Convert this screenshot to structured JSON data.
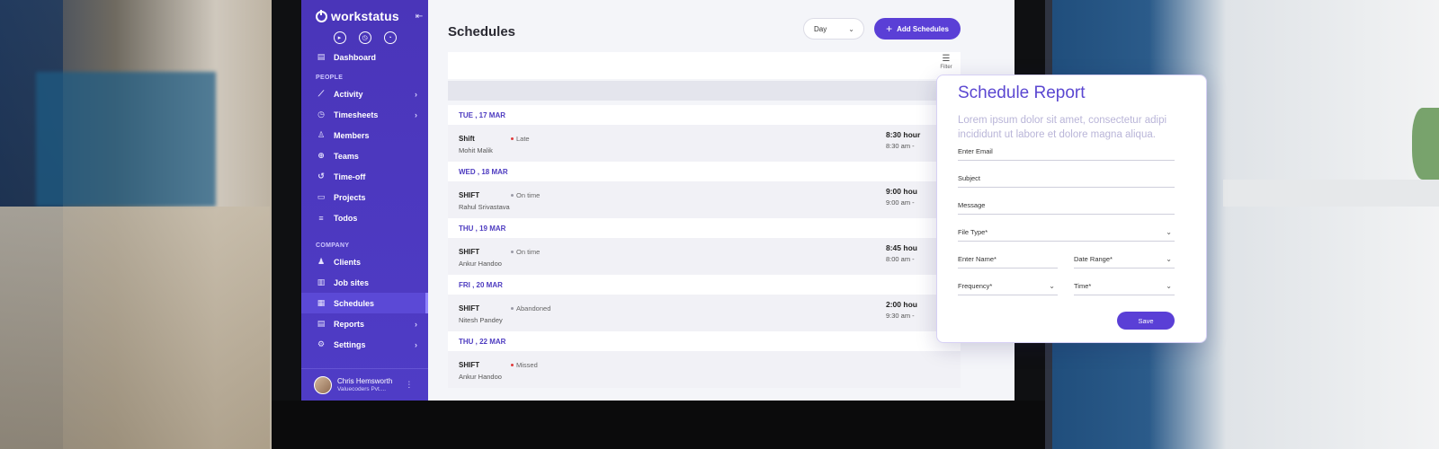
{
  "app": {
    "logo_text": "workstatus"
  },
  "sidebar": {
    "dashboard": "Dashboard",
    "people_label": "PEOPLE",
    "company_label": "COMPANY",
    "people_items": [
      {
        "label": "Activity",
        "icon": "chart-line-icon",
        "has_submenu": true
      },
      {
        "label": "Timesheets",
        "icon": "clock-icon",
        "has_submenu": true
      },
      {
        "label": "Members",
        "icon": "user-icon",
        "has_submenu": false
      },
      {
        "label": "Teams",
        "icon": "team-icon",
        "has_submenu": false
      },
      {
        "label": "Time-off",
        "icon": "time-off-icon",
        "has_submenu": false
      },
      {
        "label": "Projects",
        "icon": "folder-icon",
        "has_submenu": false
      },
      {
        "label": "Todos",
        "icon": "list-icon",
        "has_submenu": false
      }
    ],
    "company_items": [
      {
        "label": "Clients",
        "icon": "clients-icon",
        "has_submenu": false
      },
      {
        "label": "Job sites",
        "icon": "building-icon",
        "has_submenu": false
      },
      {
        "label": "Schedules",
        "icon": "calendar-icon",
        "has_submenu": false,
        "active": true
      },
      {
        "label": "Reports",
        "icon": "report-icon",
        "has_submenu": true
      },
      {
        "label": "Settings",
        "icon": "gear-icon",
        "has_submenu": true
      }
    ],
    "user": {
      "name": "Chris Hemsworth",
      "company": "Valuecoders Pvt...."
    }
  },
  "main": {
    "title": "Schedules",
    "view_select": "Day",
    "add_button": "Add Schedules",
    "filter_label": "Filter",
    "schedule_groups": [
      {
        "date": "TUE , 17 MAR",
        "title": "Shift",
        "name": "Mohit Malik",
        "status": "Late",
        "status_color": "#e03b3b",
        "hours": "8:30 hour",
        "time": "8:30 am -"
      },
      {
        "date": "WED , 18 MAR",
        "title": "SHIFT",
        "name": "Rahul Srivastava",
        "status": "On time",
        "status_color": "#9a9aa6",
        "hours": "9:00 hou",
        "time": "9:00 am -"
      },
      {
        "date": "THU , 19 MAR",
        "title": "SHIFT",
        "name": "Ankur Handoo",
        "status": "On time",
        "status_color": "#9a9aa6",
        "hours": "8:45 hou",
        "time": "8:00 am -"
      },
      {
        "date": "FRI , 20 MAR",
        "title": "SHIFT",
        "name": "Nitesh Pandey",
        "status": "Abandoned",
        "status_color": "#9a9aa6",
        "hours": "2:00 hou",
        "time": "9:30 am -"
      },
      {
        "date": "THU , 22 MAR",
        "title": "SHIFT",
        "name": "Ankur Handoo",
        "status": "Missed",
        "status_color": "#e03b3b",
        "hours": "",
        "time": ""
      }
    ]
  },
  "report": {
    "title": "Schedule Report",
    "description": "Lorem ipsum dolor sit amet, consectetur adipi incididunt ut labore et dolore magna aliqua.",
    "fields": {
      "email": "Enter Email",
      "subject": "Subject",
      "message": "Message",
      "file_type": "File Type*",
      "name": "Enter Name*",
      "date_range": "Date Range*",
      "frequency": "Frequency*",
      "time": "Time*"
    },
    "save_button": "Save"
  },
  "colors": {
    "brand": "#4a35b9",
    "accent": "#5a3fd6",
    "late": "#e03b3b"
  }
}
